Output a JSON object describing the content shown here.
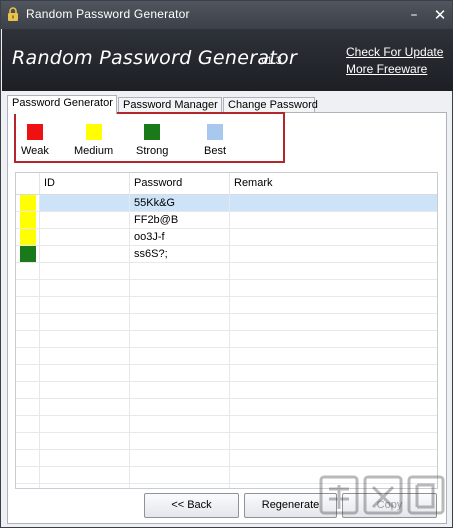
{
  "window": {
    "title": "Random Password Generator",
    "min_glyph": "–",
    "close_glyph": "✕"
  },
  "banner": {
    "title": "Random Password Generator",
    "version": "v1.3",
    "link_update": "Check For Update",
    "link_freeware": "More Freeware"
  },
  "tabs": [
    {
      "label": "Password Generator",
      "active": true
    },
    {
      "label": "Password Manager",
      "active": false
    },
    {
      "label": "Change Password",
      "active": false
    }
  ],
  "legend": [
    {
      "label": "Weak",
      "color": "#ee1111"
    },
    {
      "label": "Medium",
      "color": "#ffff00"
    },
    {
      "label": "Strong",
      "color": "#1a7a1a"
    },
    {
      "label": "Best",
      "color": "#a8c8ee"
    }
  ],
  "grid": {
    "columns": [
      "ID",
      "Password",
      "Remark"
    ],
    "rows": [
      {
        "strength_color": "#ffff00",
        "id": "",
        "password": "55Kk&G",
        "remark": "",
        "selected": true
      },
      {
        "strength_color": "#ffff00",
        "id": "",
        "password": "FF2b@B",
        "remark": "",
        "selected": false
      },
      {
        "strength_color": "#ffff00",
        "id": "",
        "password": "oo3J-f",
        "remark": "",
        "selected": false
      },
      {
        "strength_color": "#1a7a1a",
        "id": "",
        "password": "ss6S?;",
        "remark": "",
        "selected": false
      }
    ]
  },
  "buttons": {
    "back": "<< Back",
    "regenerate": "Regenerate",
    "copy": "Copy"
  },
  "icons": {
    "app": "lock-icon"
  }
}
